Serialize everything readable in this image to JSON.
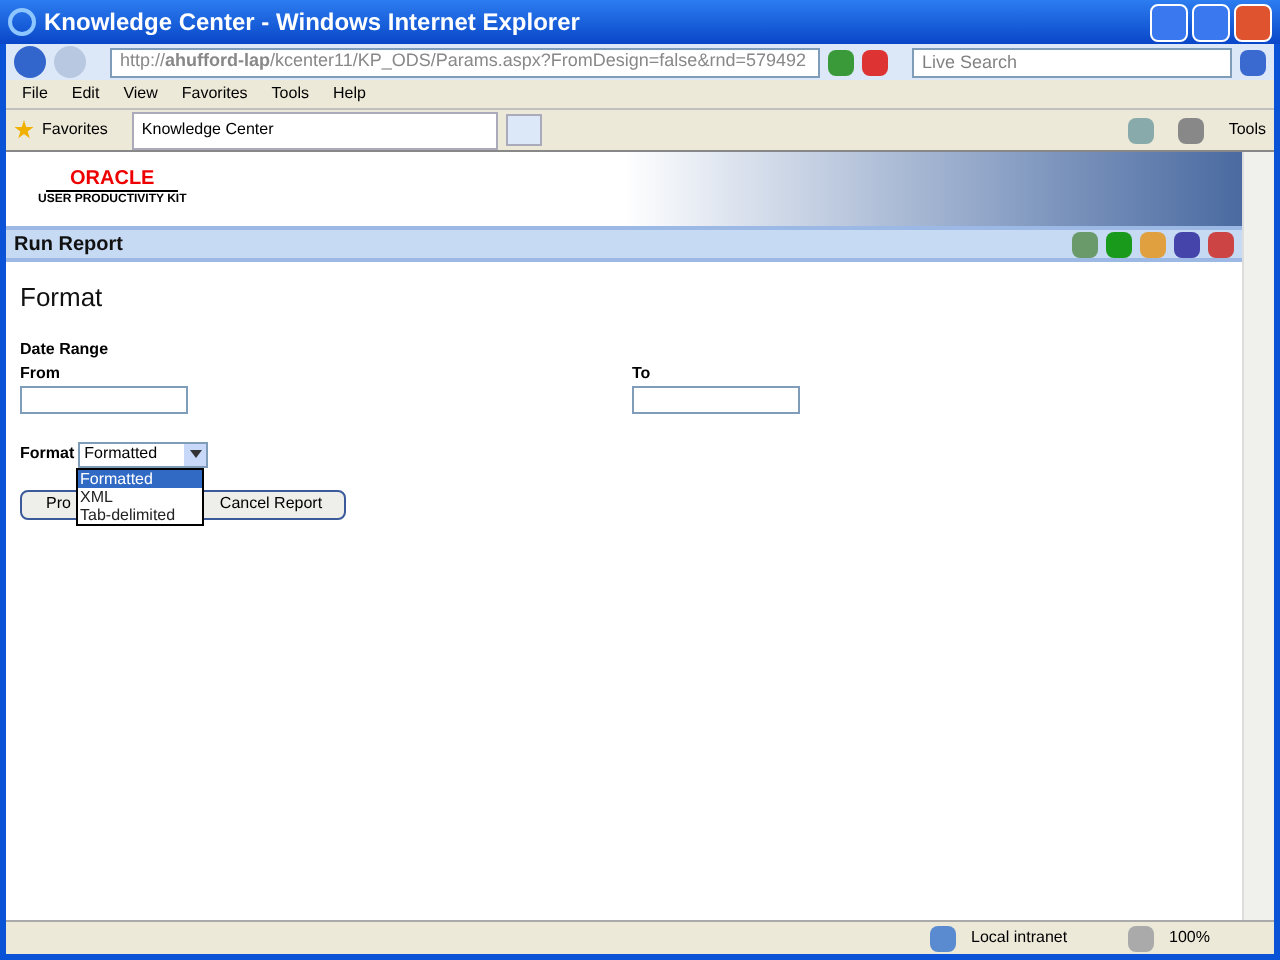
{
  "window": {
    "title": "Knowledge Center - Windows Internet Explorer"
  },
  "address_bar": {
    "url": "http://**ahufford-lap**/kcenter11/KP_ODS/Params.aspx?FromDesign=false&rnd=579492"
  },
  "search": {
    "placeholder": "Live Search"
  },
  "menu": [
    "File",
    "Edit",
    "View",
    "Favorites",
    "Tools",
    "Help"
  ],
  "favorites_bar": {
    "favorites": "Favorites",
    "tabs": [
      {
        "label": "Knowledge Center",
        "selected": true
      }
    ],
    "tools": "Tools"
  },
  "header": {
    "logo_top": "ORACLE",
    "logo_bottom": "USER PRODUCTIVITY KIT"
  },
  "toolbar": {
    "title": "Run Report"
  },
  "form": {
    "heading": "Format",
    "section": "Date Range",
    "from_label": "From",
    "to_label": "To",
    "format_label": "Format",
    "format_value": "Formatted",
    "options": [
      {
        "label": "Formatted",
        "selected": true
      },
      {
        "label": "XML",
        "selected": false
      },
      {
        "label": "Tab-delimited",
        "selected": false
      }
    ],
    "buttons": [
      "Pro",
      "Cancel Report"
    ]
  },
  "status_bar": {
    "zone": "Local intranet",
    "zoom": "100%"
  }
}
